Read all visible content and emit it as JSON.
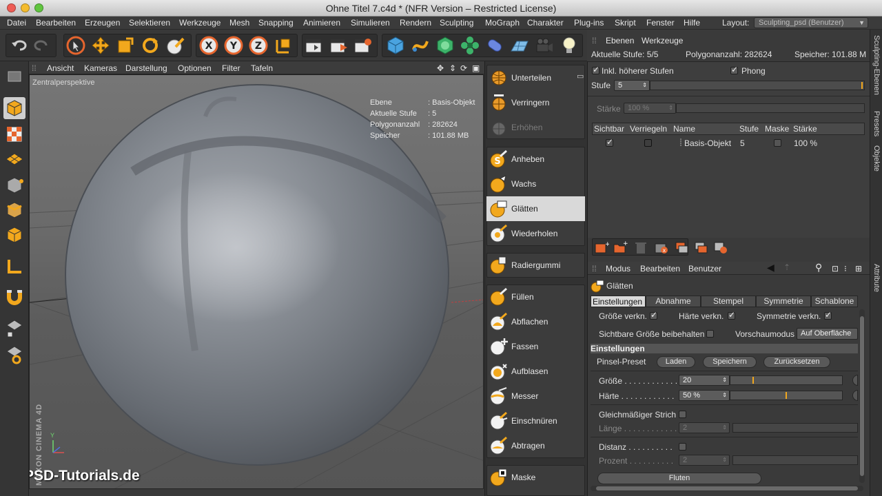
{
  "window": {
    "title": "Ohne Titel 7.c4d * (NFR Version – Restricted License)"
  },
  "menubar": {
    "items": [
      "Datei",
      "Bearbeiten",
      "Erzeugen",
      "Selektieren",
      "Werkzeuge",
      "Mesh",
      "Snapping",
      "Animieren",
      "Simulieren",
      "Rendern",
      "Sculpting",
      "MoGraph",
      "Charakter",
      "Plug-ins",
      "Skript",
      "Fenster",
      "Hilfe"
    ],
    "layout_label": "Layout:",
    "layout_value": "Sculpting_psd (Benutzer)"
  },
  "viewport": {
    "menu": [
      "Ansicht",
      "Kameras",
      "Darstellung",
      "Optionen",
      "Filter",
      "Tafeln"
    ],
    "projection": "Zentralperspektive",
    "hud": {
      "ebene_k": "Ebene",
      "ebene_v": ": Basis-Objekt",
      "stufe_k": "Aktuelle Stufe",
      "stufe_v": ": 5",
      "poly_k": "Polygonanzahl",
      "poly_v": ": 282624",
      "mem_k": "Speicher",
      "mem_v": ": 101.88 MB"
    },
    "axis_y": "Y",
    "watermark": "PSD-Tutorials.de",
    "brand": "MAXON CINEMA 4D"
  },
  "brushes": {
    "g1": [
      "Unterteilen",
      "Verringern",
      "Erhöhen"
    ],
    "g2": [
      "Anheben",
      "Wachs",
      "Glätten",
      "Wiederholen"
    ],
    "g3": [
      "Radiergummi"
    ],
    "g4": [
      "Füllen",
      "Abflachen",
      "Fassen",
      "Aufblasen",
      "Messer",
      "Einschnüren",
      "Abtragen"
    ],
    "g5": [
      "Maske"
    ]
  },
  "layers_panel": {
    "tabs": [
      "Ebenen",
      "Werkzeuge"
    ],
    "stats": {
      "stufe_label": "Aktuelle Stufe: 5/5",
      "poly_label": "Polygonanzahl: 282624",
      "mem_label": "Speicher: 101.88 M"
    },
    "inkl_label": "Inkl. höherer Stufen",
    "phong_label": "Phong",
    "stufe_field_label": "Stufe",
    "stufe_value": "5",
    "staerke_label": "Stärke",
    "staerke_value": "100 %",
    "columns": [
      "Sichtbar",
      "Verriegeln",
      "Name",
      "Stufe",
      "Maske",
      "Stärke"
    ],
    "row": {
      "name": "Basis-Objekt",
      "stufe": "5",
      "staerke": "100 %"
    }
  },
  "attr_panel": {
    "menu": [
      "Modus",
      "Bearbeiten",
      "Benutzer"
    ],
    "tool_title": "Glätten",
    "tabs": [
      "Einstellungen",
      "Abnahme",
      "Stempel",
      "Symmetrie",
      "Schablone"
    ],
    "groesse_verkn": "Größe verkn.",
    "haerte_verkn": "Härte verkn.",
    "symmetrie_verkn": "Symmetrie verkn.",
    "sichtbare_groesse": "Sichtbare Größe beibehalten",
    "vorschau_label": "Vorschaumodus",
    "vorschau_value": "Auf Oberfläche",
    "section": "Einstellungen",
    "pinsel_preset": "Pinsel-Preset",
    "btn_laden": "Laden",
    "btn_speichern": "Speichern",
    "btn_reset": "Zurücksetzen",
    "groesse_label": "Größe . . . . . . . . . . . .",
    "groesse_value": "20",
    "groesse_fraction": 0.2,
    "haerte_label": "Härte . . . . . . . . . . . .",
    "haerte_value": "50 %",
    "haerte_fraction": 0.5,
    "gleich_label": "Gleichmäßiger Strich",
    "laenge_label": "Länge . . . . . . . . . . . .",
    "laenge_value": "2",
    "distanz_label": "Distanz . . . . . . . . . .",
    "prozent_label": "Prozent . . . . . . . . . .",
    "prozent_value": "2",
    "btn_fluten": "Fluten"
  },
  "vertical_tabs": [
    "Sculpting-Ebenen",
    "Presets",
    "Objekte",
    "Attribute"
  ]
}
